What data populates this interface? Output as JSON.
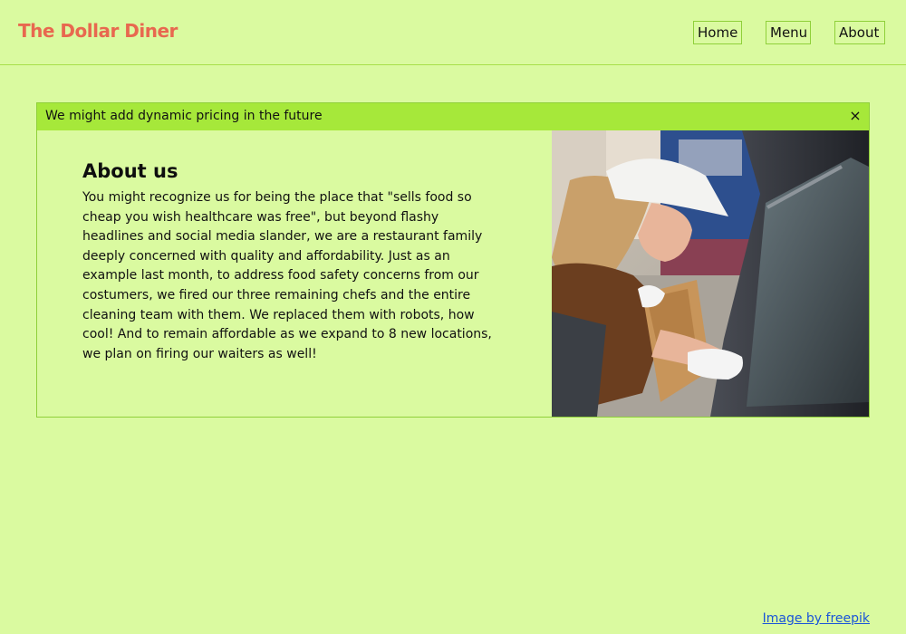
{
  "header": {
    "brand": "The Dollar Diner",
    "nav": {
      "home": "Home",
      "menu": "Menu",
      "about": "About"
    }
  },
  "banner": {
    "text": "We might add dynamic pricing in the future",
    "close": "×"
  },
  "about": {
    "title": "About us",
    "body": "You might recognize us for being the place that \"sells food so cheap you wish healthcare was free\", but beyond flashy headlines and social media slander, we are a restaurant family deeply concerned with quality and affordability. Just as an example last month, to address food safety concerns from our costumers, we fired our three remaining chefs and the entire cleaning team with them. We replaced them with robots, how cool! And to remain affordable as we expand to 8 new locations, we plan on firing our waiters as well!"
  },
  "footer": {
    "credit": "Image by freepik"
  },
  "colors": {
    "background": "#dafaa0",
    "accent": "#a6e83a",
    "brand": "#e8684f",
    "link": "#1a55d8"
  }
}
